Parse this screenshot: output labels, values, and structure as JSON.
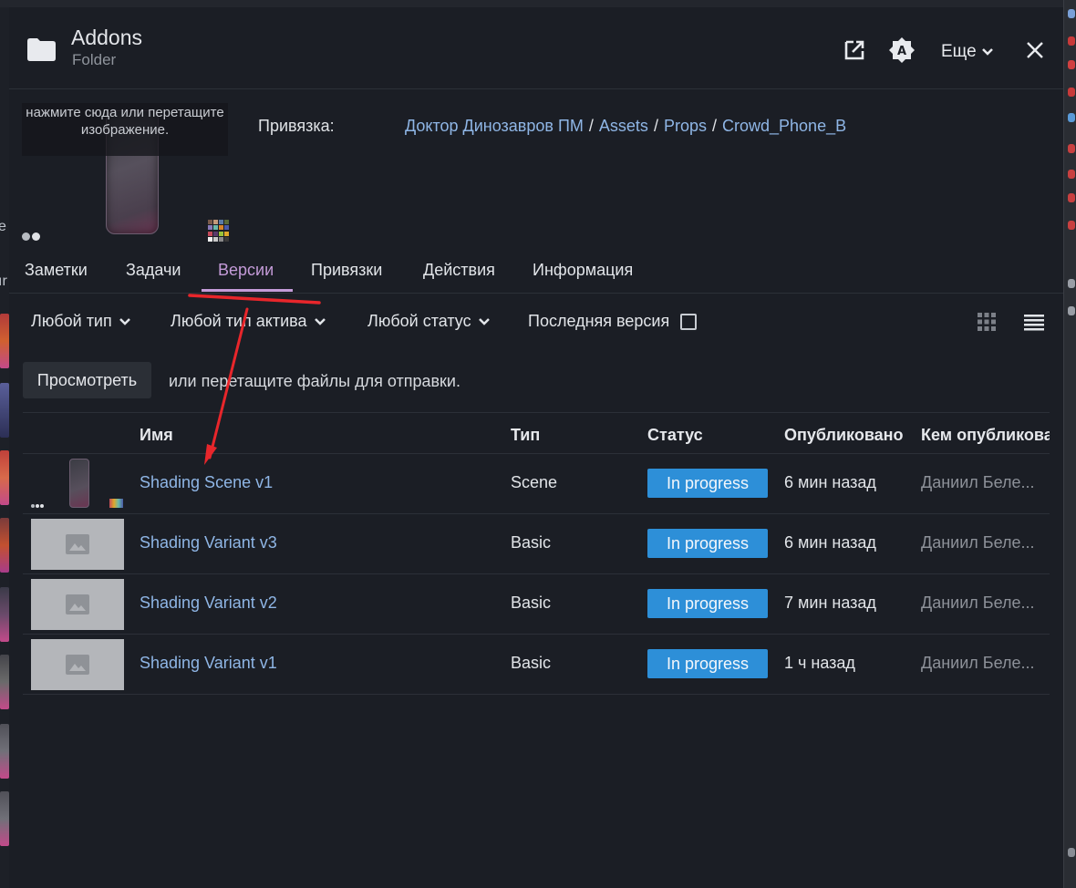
{
  "header": {
    "title": "Addons",
    "subtitle": "Folder",
    "more_label": "Еще"
  },
  "thumbnail": {
    "upload_hint": "нажмите сюда или перетащите изображение."
  },
  "link": {
    "label": "Привязка:",
    "breadcrumb": [
      "Доктор Динозавров ПМ",
      "Assets",
      "Props",
      "Crowd_Phone_B"
    ]
  },
  "tabs": [
    {
      "label": "Заметки"
    },
    {
      "label": "Задачи"
    },
    {
      "label": "Версии",
      "active": true
    },
    {
      "label": "Привязки"
    },
    {
      "label": "Действия"
    },
    {
      "label": "Информация"
    }
  ],
  "filters": {
    "any_type": "Любой тип",
    "any_asset_type": "Любой тип актива",
    "any_status": "Любой статус",
    "latest_version": "Последняя версия",
    "latest_version_checked": false
  },
  "upload": {
    "browse_label": "Просмотреть",
    "drop_text": "или перетащите файлы для отправки."
  },
  "table": {
    "columns": [
      "Имя",
      "Тип",
      "Статус",
      "Опубликовано",
      "Кем опубликова"
    ],
    "rows": [
      {
        "name": "Shading Scene v1",
        "type": "Scene",
        "status": "In progress",
        "published": "6 мин назад",
        "author": "Даниил Беле...",
        "thumb": "scene"
      },
      {
        "name": "Shading Variant v3",
        "type": "Basic",
        "status": "In progress",
        "published": "6 мин назад",
        "author": "Даниил Беле...",
        "thumb": "placeholder"
      },
      {
        "name": "Shading Variant v2",
        "type": "Basic",
        "status": "In progress",
        "published": "7 мин назад",
        "author": "Даниил Беле...",
        "thumb": "placeholder"
      },
      {
        "name": "Shading Variant v1",
        "type": "Basic",
        "status": "In progress",
        "published": "1 ч назад",
        "author": "Даниил Беле...",
        "thumb": "placeholder"
      }
    ]
  },
  "colors": {
    "background": "#1b1e25",
    "accent_tab": "#c49bd8",
    "link": "#8fb6e6",
    "status_in_progress": "#2d8fd8",
    "annotation_red": "#e8262b"
  },
  "icons": [
    "folder-icon",
    "open-external-icon",
    "auto-avatar-icon",
    "chevron-down-icon",
    "close-icon",
    "grid-view-icon",
    "list-view-icon",
    "image-placeholder-icon"
  ]
}
